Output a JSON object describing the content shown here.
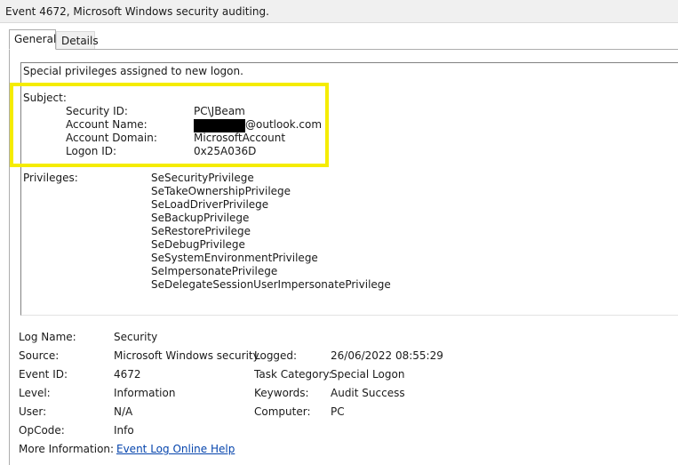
{
  "window": {
    "title": "Event 4672, Microsoft Windows security auditing."
  },
  "tabs": [
    {
      "label": "General",
      "selected": true
    },
    {
      "label": "Details",
      "selected": false
    }
  ],
  "description": {
    "headline": "Special privileges assigned to new logon.",
    "subject_label": "Subject:",
    "subject": {
      "security_id": {
        "label": "Security ID:",
        "value": "PC\\JBeam"
      },
      "account_name": {
        "label": "Account Name:",
        "value": "@outlook.com"
      },
      "account_domain": {
        "label": "Account Domain:",
        "value": "MicrosoftAccount"
      },
      "logon_id": {
        "label": "Logon ID:",
        "value": "0x25A036D"
      }
    },
    "privileges_label": "Privileges:",
    "privileges": [
      "SeSecurityPrivilege",
      "SeTakeOwnershipPrivilege",
      "SeLoadDriverPrivilege",
      "SeBackupPrivilege",
      "SeRestorePrivilege",
      "SeDebugPrivilege",
      "SeSystemEnvironmentPrivilege",
      "SeImpersonatePrivilege",
      "SeDelegateSessionUserImpersonatePrivilege"
    ]
  },
  "details": {
    "log_name": {
      "label": "Log Name:",
      "value": "Security"
    },
    "source": {
      "label": "Source:",
      "value": "Microsoft Windows security"
    },
    "logged": {
      "label": "Logged:",
      "value": "26/06/2022 08:55:29"
    },
    "event_id": {
      "label": "Event ID:",
      "value": "4672"
    },
    "task_category": {
      "label": "Task Category:",
      "value": "Special Logon"
    },
    "level": {
      "label": "Level:",
      "value": "Information"
    },
    "keywords": {
      "label": "Keywords:",
      "value": "Audit Success"
    },
    "user": {
      "label": "User:",
      "value": "N/A"
    },
    "computer": {
      "label": "Computer:",
      "value": "PC"
    },
    "opcode": {
      "label": "OpCode:",
      "value": "Info"
    },
    "more_information": {
      "label": "More Information:",
      "link": "Event Log Online Help"
    }
  },
  "colors": {
    "highlight": "#f5ec00",
    "link": "#0645ad",
    "redaction": "#000000"
  }
}
